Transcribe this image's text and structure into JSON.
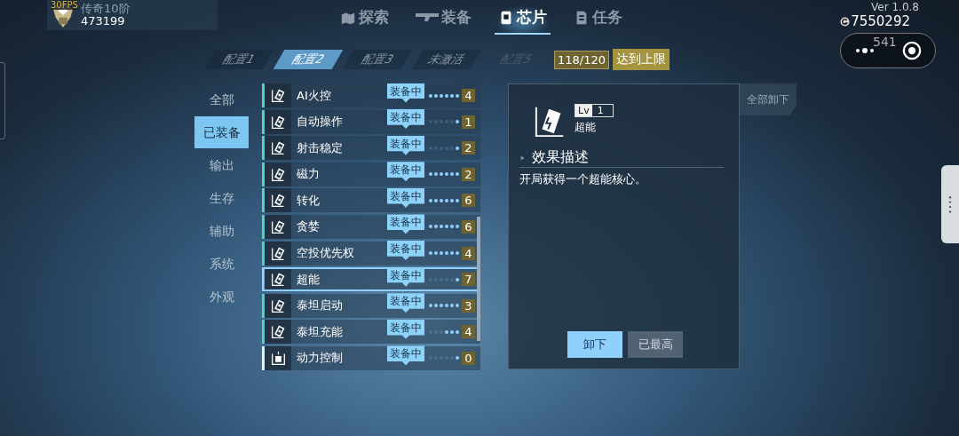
{
  "fps": "30FPS",
  "rank": {
    "title": "传奇10阶",
    "score": "473199"
  },
  "nav": [
    {
      "label": "探索",
      "selected": false
    },
    {
      "label": "装备",
      "selected": false
    },
    {
      "label": "芯片",
      "selected": true
    },
    {
      "label": "任务",
      "selected": false
    }
  ],
  "version": "Ver 1.0.8",
  "gold": "7550292",
  "gems": "541",
  "configs": [
    {
      "label": "配置1",
      "selected": false,
      "disabled": false
    },
    {
      "label": "配置2",
      "selected": true,
      "disabled": false
    },
    {
      "label": "配置3",
      "selected": false,
      "disabled": false
    },
    {
      "label": "未激活",
      "selected": false,
      "disabled": false
    },
    {
      "label": "配置5",
      "selected": false,
      "disabled": true
    }
  ],
  "capacity": "118/120",
  "capacity_note": "达到上限",
  "categories": [
    {
      "label": "全部",
      "selected": false
    },
    {
      "label": "已装备",
      "selected": true
    },
    {
      "label": "输出",
      "selected": false
    },
    {
      "label": "生存",
      "selected": false
    },
    {
      "label": "辅助",
      "selected": false
    },
    {
      "label": "系统",
      "selected": false
    },
    {
      "label": "外观",
      "selected": false
    }
  ],
  "chips": [
    {
      "name": "AI火控",
      "status": "装备中",
      "level": "4",
      "kind": "chip",
      "stars": 6,
      "selected": false
    },
    {
      "name": "自动操作",
      "status": "装备中",
      "level": "1",
      "kind": "chip",
      "stars": 1,
      "selected": false
    },
    {
      "name": "射击稳定",
      "status": "装备中",
      "level": "2",
      "kind": "chip",
      "stars": 1,
      "selected": false
    },
    {
      "name": "磁力",
      "status": "装备中",
      "level": "2",
      "kind": "chip",
      "stars": 6,
      "selected": false
    },
    {
      "name": "转化",
      "status": "装备中",
      "level": "6",
      "kind": "chip",
      "stars": 6,
      "selected": false
    },
    {
      "name": "贪婪",
      "status": "装备中",
      "level": "6",
      "kind": "chip",
      "stars": 6,
      "selected": false
    },
    {
      "name": "空投优先权",
      "status": "装备中",
      "level": "4",
      "kind": "chip",
      "stars": 6,
      "selected": false
    },
    {
      "name": "超能",
      "status": "装备中",
      "level": "7",
      "kind": "chip",
      "stars": 1,
      "selected": true
    },
    {
      "name": "泰坦启动",
      "status": "装备中",
      "level": "3",
      "kind": "chip",
      "stars": 6,
      "selected": false
    },
    {
      "name": "泰坦充能",
      "status": "装备中",
      "level": "4",
      "kind": "chip",
      "stars": 3,
      "selected": false
    },
    {
      "name": "动力控制",
      "status": "装备中",
      "level": "0",
      "kind": "module",
      "stars": 1,
      "selected": false
    }
  ],
  "detail": {
    "lv_label": "Lv",
    "lv": "1",
    "name": "超能",
    "section": "效果描述",
    "description": "开局获得一个超能核心。",
    "buttons": [
      {
        "label": "卸下",
        "disabled": false
      },
      {
        "label": "已最高",
        "disabled": true
      }
    ]
  },
  "unequip_all": "全部卸下"
}
